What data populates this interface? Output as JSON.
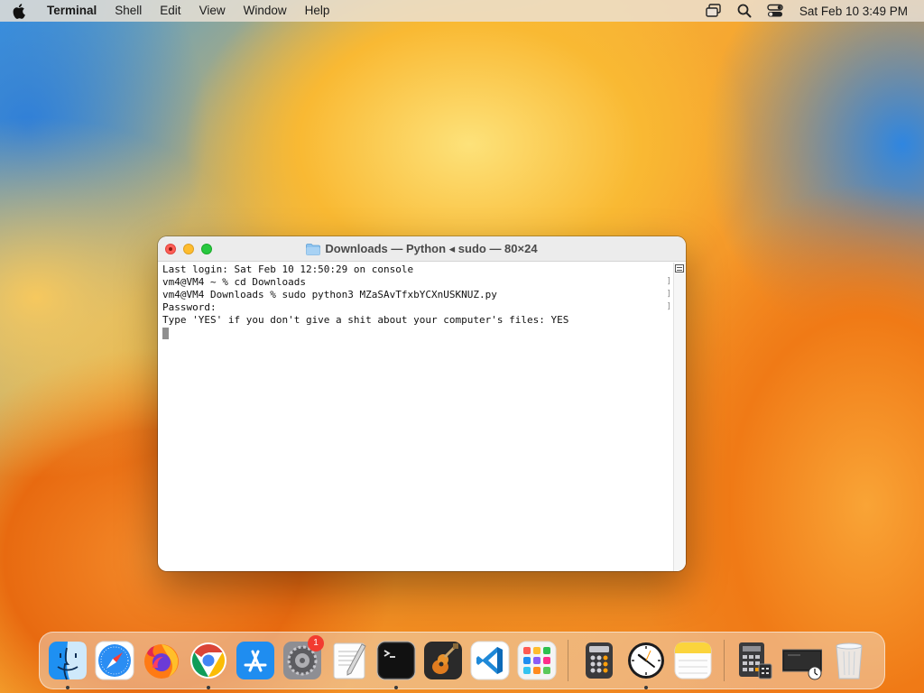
{
  "menubar": {
    "app_name": "Terminal",
    "items": [
      "Shell",
      "Edit",
      "View",
      "Window",
      "Help"
    ],
    "clock": "Sat Feb 10  3:49 PM"
  },
  "window": {
    "title": "Downloads — Python ◂ sudo — 80×24",
    "lines": [
      "Last login: Sat Feb 10 12:50:29 on console",
      "vm4@VM4 ~ % cd Downloads",
      "vm4@VM4 Downloads % sudo python3 MZaSAvTfxbYCXnUSKNUZ.py",
      "Password:",
      "Type 'YES' if you don't give a shit about your computer's files: YES"
    ]
  },
  "dock": {
    "apps": [
      {
        "name": "Finder",
        "icon": "finder-icon",
        "running": true
      },
      {
        "name": "Safari",
        "icon": "safari-icon",
        "running": false
      },
      {
        "name": "Firefox",
        "icon": "firefox-icon",
        "running": false
      },
      {
        "name": "Google Chrome",
        "icon": "chrome-icon",
        "running": true
      },
      {
        "name": "App Store",
        "icon": "app-store-icon",
        "running": false
      },
      {
        "name": "System Settings",
        "icon": "system-settings-icon",
        "running": false,
        "badge": "1"
      },
      {
        "name": "TextEdit",
        "icon": "textedit-icon",
        "running": false
      },
      {
        "name": "Terminal",
        "icon": "terminal-icon",
        "running": true
      },
      {
        "name": "Instruments",
        "icon": "instruments-icon",
        "running": false
      },
      {
        "name": "Visual Studio Code",
        "icon": "vscode-icon",
        "running": false
      },
      {
        "name": "Launchpad",
        "icon": "launchpad-icon",
        "running": false
      },
      {
        "name": "Calculator",
        "icon": "calculator-icon",
        "running": false
      },
      {
        "name": "Clock",
        "icon": "clock-icon",
        "running": true
      },
      {
        "name": "Notes",
        "icon": "notes-icon",
        "running": false
      },
      {
        "name": "Calculator Stack",
        "icon": "calculator-stack-icon",
        "running": false
      },
      {
        "name": "Screenshots Stack",
        "icon": "screenshots-stack-icon",
        "running": false
      },
      {
        "name": "Trash",
        "icon": "trash-icon",
        "running": false
      }
    ]
  },
  "colors": {
    "close": "#fe5f57",
    "minimize": "#febc2e",
    "zoom": "#28c840",
    "badge": "#f23b30"
  }
}
